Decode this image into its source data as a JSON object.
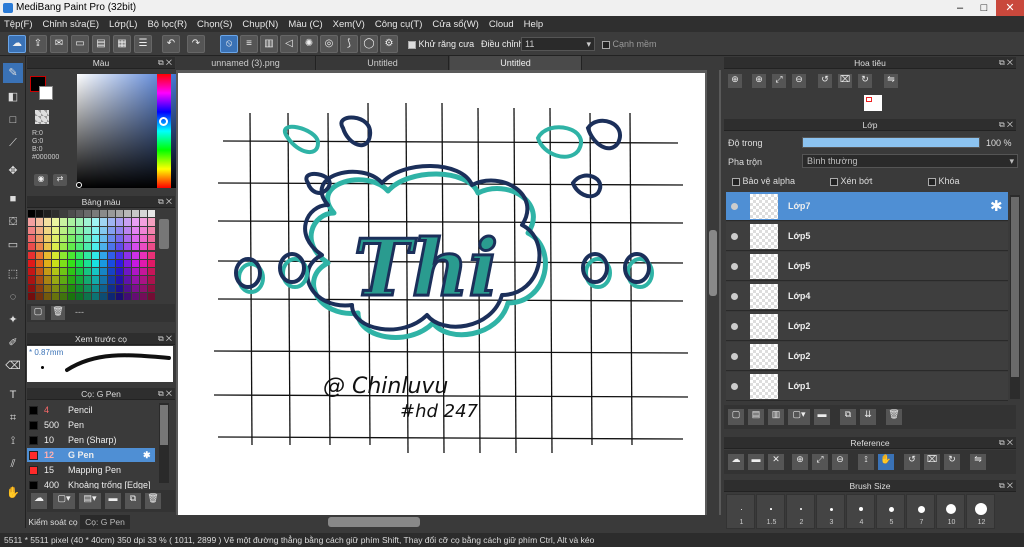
{
  "window": {
    "title": "MediBang Paint Pro (32bit)"
  },
  "menu": [
    "Tệp(F)",
    "Chỉnh sửa(E)",
    "Lớp(L)",
    "Bộ lọc(R)",
    "Chọn(S)",
    "Chụp(N)",
    "Màu (C)",
    "Xem(V)",
    "Công cụ(T)",
    "Cửa sổ(W)",
    "Cloud",
    "Help"
  ],
  "toolbar": {
    "antialias_label": "Khử răng cưa",
    "adjust_label": "Điều chỉnh",
    "adjust_value": "11",
    "snap_label": "Cạnh mềm"
  },
  "color_panel": {
    "title": "Màu",
    "r": "R:0",
    "g": "G:0",
    "b": "B:0",
    "hex": "#000000"
  },
  "palette_panel": {
    "title": "Bảng màu",
    "extra": "---"
  },
  "brush_preview": {
    "title": "Xem trước cọ",
    "size": "0.87mm"
  },
  "brush_panel": {
    "title": "Cọ: G Pen",
    "items": [
      {
        "size": "4",
        "name": "Pencil",
        "color": "#000000"
      },
      {
        "size": "500",
        "name": "Pen",
        "color": "#000000"
      },
      {
        "size": "10",
        "name": "Pen (Sharp)",
        "color": "#000000"
      },
      {
        "size": "12",
        "name": "G Pen",
        "color": "#ff2a2a",
        "selected": true
      },
      {
        "size": "15",
        "name": "Mapping Pen",
        "color": "#ff2a2a"
      },
      {
        "size": "400",
        "name": "Khoảng trống [Edge]",
        "color": "#000000"
      }
    ],
    "bottom_tabs": [
      "Kiểm soát cọ",
      "Cọ: G Pen"
    ]
  },
  "tabs": [
    "unnamed (3).png",
    "Untitled",
    "Untitled"
  ],
  "artwork": {
    "word": "Thi",
    "signature": "@ Chinluvu",
    "tag": "#hd 247"
  },
  "navigator": {
    "title": "Hoa tiêu"
  },
  "layers": {
    "title": "Lớp",
    "opacity_label": "Độ trong",
    "opacity_value": "100 %",
    "opacity_fraction": 1.0,
    "blend_label": "Pha trộn",
    "blend_value": "Bình thường",
    "protect_alpha": "Bảo vệ alpha",
    "clip": "Xén bớt",
    "lock": "Khóa",
    "items": [
      "Lớp7",
      "Lớp5",
      "Lớp5",
      "Lớp4",
      "Lớp2",
      "Lớp2",
      "Lớp1"
    ]
  },
  "reference": {
    "title": "Reference"
  },
  "brush_size": {
    "title": "Brush Size",
    "sizes": [
      "1",
      "1.5",
      "2",
      "3",
      "4",
      "5",
      "7",
      "10",
      "12"
    ]
  },
  "status": {
    "text": "5511 * 5511 pixel  (40 * 40cm)  350 dpi  33 %  ( 1011, 2899 )  Vẽ một đường thẳng bằng cách giữ phím Shift, Thay đổi cỡ cọ bằng cách giữ phím Ctrl, Alt và kéo"
  },
  "colors": {
    "accent": "#4f8fd4",
    "teal": "#2fb3a6",
    "navy": "#1b2f5a"
  }
}
